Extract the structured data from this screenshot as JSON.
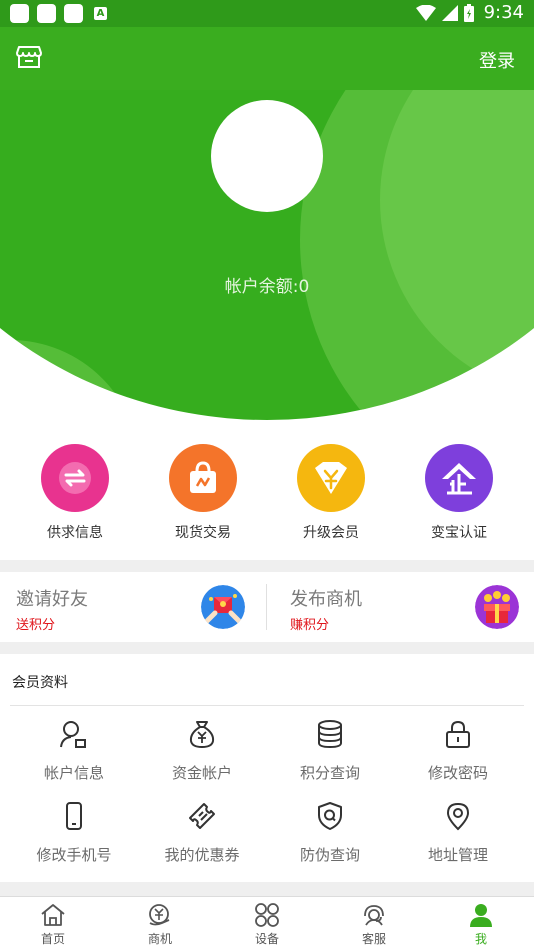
{
  "status_bar": {
    "time": "9:34",
    "notification_letter": "A"
  },
  "toolbar": {
    "login_label": "登录"
  },
  "header": {
    "balance_text": "帐户余额:0"
  },
  "quick_actions": [
    {
      "label": "供求信息",
      "icon": "exchange-arrows-icon",
      "color": "#e8338f"
    },
    {
      "label": "现货交易",
      "icon": "shopping-bag-icon",
      "color": "#f4742a"
    },
    {
      "label": "升级会员",
      "icon": "diamond-yuan-icon",
      "color": "#f5b70f"
    },
    {
      "label": "变宝认证",
      "icon": "enterprise-badge-icon",
      "color": "#7e3fdc"
    }
  ],
  "promos": [
    {
      "title": "邀请好友",
      "subtitle": "送积分",
      "icon": "invite-friends-icon"
    },
    {
      "title": "发布商机",
      "subtitle": "赚积分",
      "icon": "gift-coins-icon"
    }
  ],
  "member": {
    "title": "会员资料",
    "items": [
      {
        "label": "帐户信息",
        "icon": "account-info-icon"
      },
      {
        "label": "资金帐户",
        "icon": "money-bag-icon"
      },
      {
        "label": "积分查询",
        "icon": "coin-stack-icon"
      },
      {
        "label": "修改密码",
        "icon": "lock-icon"
      },
      {
        "label": "修改手机号",
        "icon": "phone-icon"
      },
      {
        "label": "我的优惠券",
        "icon": "coupon-icon"
      },
      {
        "label": "防伪查询",
        "icon": "shield-check-icon"
      },
      {
        "label": "地址管理",
        "icon": "location-pin-icon"
      }
    ]
  },
  "bottom_nav": [
    {
      "label": "首页",
      "icon": "home-icon",
      "active": false
    },
    {
      "label": "商机",
      "icon": "business-icon",
      "active": false
    },
    {
      "label": "设备",
      "icon": "devices-grid-icon",
      "active": false
    },
    {
      "label": "客服",
      "icon": "customer-service-icon",
      "active": false
    },
    {
      "label": "我",
      "icon": "me-person-icon",
      "active": true
    }
  ],
  "colors": {
    "primary_green": "#3aad1f",
    "status_green": "#2f9a1a",
    "red_text": "#e0151b"
  }
}
